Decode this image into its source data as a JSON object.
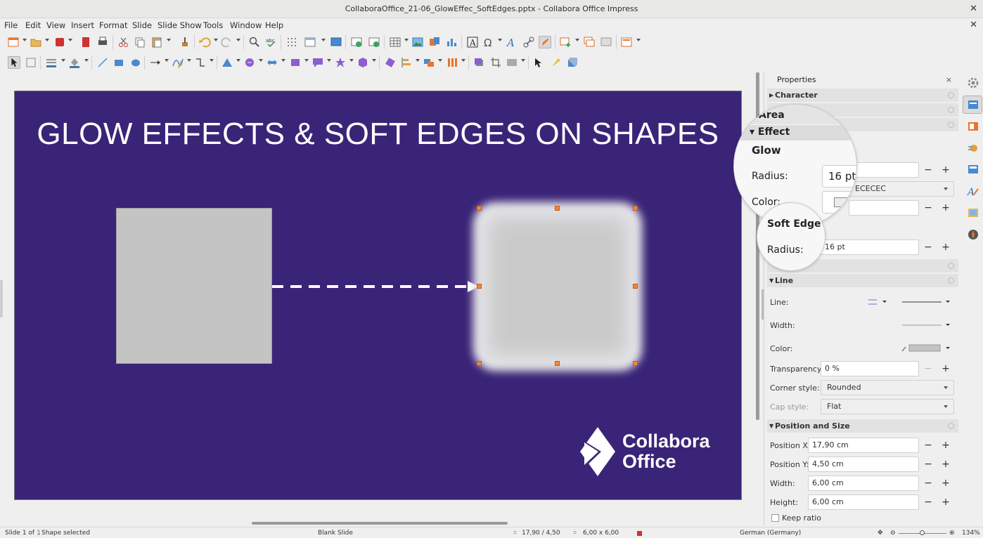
{
  "window": {
    "title": "CollaboraOffice_21-06_GlowEffec_SoftEdges.pptx - Collabora Office Impress",
    "close": "✕"
  },
  "menu": [
    "File",
    "Edit",
    "View",
    "Insert",
    "Format",
    "Slide",
    "Slide Show",
    "Tools",
    "Window",
    "Help"
  ],
  "slide": {
    "title": "GLOW EFFECTS & SOFT EDGES ON SHAPES",
    "logo_line1": "Collabora",
    "logo_line2": "Office",
    "colors": {
      "background": "#3a2477",
      "shape": "#c4c4c4",
      "glow": "#ececec",
      "handle": "#f2873b"
    }
  },
  "sidebar": {
    "title": "Properties",
    "close": "×",
    "sections": {
      "character": "Character",
      "line": "Line",
      "position": "Position and Size"
    },
    "glow": {
      "radius": "16 pt",
      "color_hex": "ECECEC"
    },
    "soft_edge": {
      "radius": "16 pt"
    },
    "line": {
      "line_label": "Line:",
      "width_label": "Width:",
      "color_label": "Color:",
      "transparency_label": "Transparency:",
      "transparency": "0 %",
      "corner_label": "Corner style:",
      "corner": "Rounded",
      "cap_label": "Cap style:",
      "cap": "Flat"
    },
    "position": {
      "x_label": "Position X:",
      "x": "17,90 cm",
      "y_label": "Position Y:",
      "y": "4,50 cm",
      "w_label": "Width:",
      "w": "6,00 cm",
      "h_label": "Height:",
      "h": "6,00 cm",
      "keep_ratio": "Keep ratio"
    }
  },
  "magnifier": {
    "area": "Area",
    "effect": "Effect",
    "glow": "Glow",
    "radius_label": "Radius:",
    "radius_value": "16 pt",
    "color_label": "Color:",
    "soft_edge": "Soft Edge",
    "soft_radius_label": "Radius:"
  },
  "status": {
    "slide": "Slide 1 of 1",
    "selection": "Shape selected",
    "layout": "Blank Slide",
    "position": "17,90 / 4,50",
    "size": "6,00 x 6,00",
    "language": "German (Germany)",
    "zoom": "134%"
  }
}
